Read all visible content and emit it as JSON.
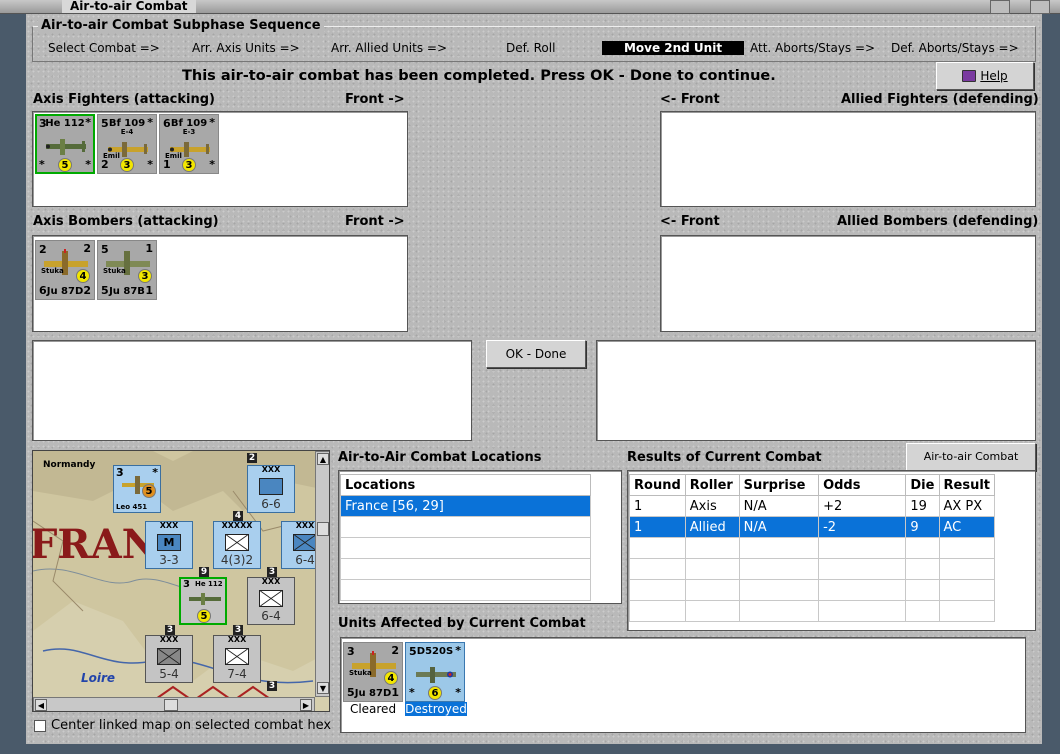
{
  "window": {
    "title": "Air-to-air Combat"
  },
  "sequence": {
    "title": "Air-to-air Combat Subphase Sequence",
    "steps": [
      "Select Combat =>",
      "Arr. Axis Units =>",
      "Arr. Allied Units =>",
      "Def. Roll",
      "Move 2nd Unit",
      "Att. Aborts/Stays =>",
      "Def. Aborts/Stays =>"
    ],
    "active_step": "Move 2nd Unit"
  },
  "status_message": "This air-to-air combat has been completed.  Press OK - Done to continue.",
  "help_button": {
    "label": "Help",
    "icon": "help-book-icon"
  },
  "axis_fighters": {
    "title": "Axis Fighters (attacking)",
    "front": "Front ->",
    "units": [
      {
        "name": "He 112",
        "sub": "",
        "tl": "3",
        "tr": "*",
        "bl": "*",
        "br": "*",
        "circle": "5",
        "nick": ""
      },
      {
        "name": "Bf 109",
        "sub": "E-4",
        "tl": "5",
        "tr": "*",
        "bl": "2",
        "br": "*",
        "circle": "3",
        "nick": "Emil"
      },
      {
        "name": "Bf 109",
        "sub": "E-3",
        "tl": "6",
        "tr": "*",
        "bl": "1",
        "br": "*",
        "circle": "3",
        "nick": "Emil"
      }
    ]
  },
  "allied_fighters": {
    "title": "Allied Fighters (defending)",
    "front": "<- Front"
  },
  "axis_bombers": {
    "title": "Axis Bombers (attacking)",
    "front": "Front ->",
    "units": [
      {
        "name": "Ju 87D",
        "tl": "2",
        "tr": "2",
        "bl": "6",
        "br": "2",
        "circle": "4",
        "nick": "Stuka"
      },
      {
        "name": "Ju 87B",
        "tl": "5",
        "tr": "1",
        "bl": "5",
        "br": "1",
        "circle": "3",
        "nick": "Stuka"
      }
    ]
  },
  "allied_bombers": {
    "title": "Allied Bombers (defending)",
    "front": "<- Front"
  },
  "ok_button": {
    "label": "OK - Done"
  },
  "locations": {
    "title": "Air-to-Air Combat Locations",
    "header": "Locations",
    "rows": [
      "France [56, 29]"
    ]
  },
  "results": {
    "title": "Results of Current Combat",
    "chart_button": "Air-to-air Combat Chart",
    "columns": [
      "Round",
      "Roller",
      "Surprise",
      "Odds",
      "Die",
      "Result"
    ],
    "rows": [
      [
        "1",
        "Axis",
        "N/A",
        "+2",
        "19",
        "AX PX"
      ],
      [
        "1",
        "Allied",
        "N/A",
        "-2",
        "9",
        "AC"
      ]
    ]
  },
  "affected": {
    "title": "Units Affected by Current Combat",
    "units": [
      {
        "name": "Ju 87D",
        "nick": "Stuka",
        "tl": "3",
        "tr": "2",
        "bl": "5",
        "br": "1",
        "circle": "4",
        "status": "Cleared"
      },
      {
        "name": "D520S",
        "tl": "5",
        "tr": "*",
        "bl": "*",
        "br": "*",
        "circle": "6",
        "status": "Destroyed"
      }
    ]
  },
  "map": {
    "labels": {
      "region": "Normandy",
      "country": "FRANC",
      "river": "Loire"
    },
    "air_counter": {
      "tl": "3",
      "tr": "*",
      "name": "Leo 451",
      "circle": "5"
    },
    "sel_counter": {
      "tl": "3",
      "name": "He 112",
      "circle": "5"
    },
    "units": [
      {
        "size": "XXX",
        "side": "XIV Mech",
        "value": "6-6",
        "sym": "armor"
      },
      {
        "size": "XXX",
        "side": "Mech",
        "value": "3-3",
        "sym": "M"
      },
      {
        "size": "XXXXX",
        "side": "Georges",
        "value": "4(3)2",
        "sym": "inf"
      },
      {
        "size": "XXX",
        "side": "V Inf",
        "value": "6-4",
        "sym": "inf"
      },
      {
        "size": "XXX",
        "side": "",
        "value": "6-4",
        "sym": "inf"
      },
      {
        "size": "XXX",
        "side": "XXXI Inf",
        "value": "5-4",
        "sym": "inf"
      },
      {
        "size": "XXX",
        "side": "XXII Inf",
        "value": "7-4",
        "sym": "inf"
      }
    ],
    "stack_counts": [
      "2",
      "4",
      "9",
      "3",
      "3",
      "3",
      "3"
    ]
  },
  "center_checkbox": {
    "label": "Center linked map on selected combat hex",
    "checked": false
  }
}
